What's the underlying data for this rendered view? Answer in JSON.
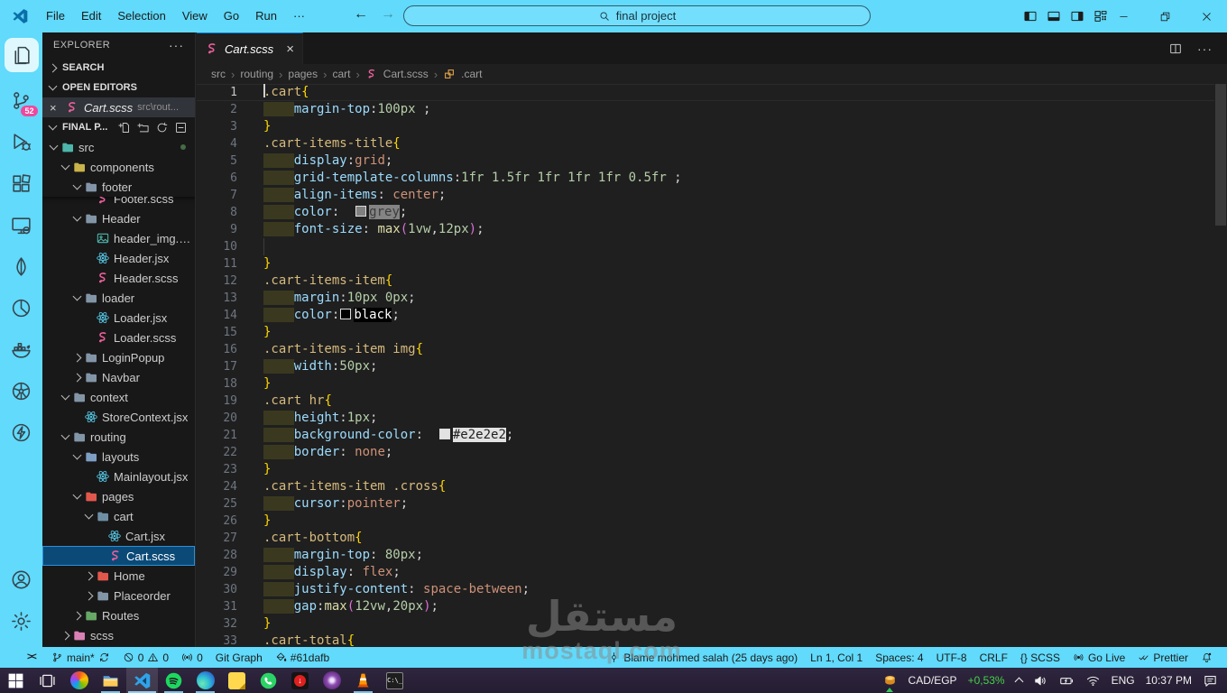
{
  "window": {
    "title_search": "final project",
    "menu": [
      "File",
      "Edit",
      "Selection",
      "View",
      "Go",
      "Run",
      "···"
    ],
    "nav": {
      "back": "←",
      "forward": "→"
    },
    "controls": {
      "minimize": "–",
      "restore": "restore",
      "close": "×"
    }
  },
  "theme": {
    "accent": "#61dafb",
    "editor_bg": "#1f1f1f",
    "sidebar_bg": "#181818",
    "selection_bg": "#0b4a77",
    "badge_pink": "#f0479c",
    "token_colors": {
      "selector": "#d7ba7d",
      "brace": "#ffd700",
      "property": "#9cdcfe",
      "number": "#b5cea8",
      "value": "#ce9178",
      "function": "#dcdcaa",
      "paren": "#da70d6"
    }
  },
  "activity_bar": {
    "top": [
      {
        "icon": "files",
        "active": true
      },
      {
        "icon": "source-control",
        "badge": "52"
      },
      {
        "icon": "run-debug"
      },
      {
        "icon": "extensions"
      },
      {
        "icon": "remote-explorer"
      },
      {
        "icon": "mongodb"
      },
      {
        "icon": "pie"
      },
      {
        "icon": "docker"
      },
      {
        "icon": "kubernetes"
      },
      {
        "icon": "thunder"
      }
    ],
    "bottom": [
      {
        "icon": "account"
      },
      {
        "icon": "gear"
      }
    ]
  },
  "sidebar": {
    "title": "EXPLORER",
    "sections": [
      {
        "label": "SEARCH",
        "collapsed": true
      },
      {
        "label": "OPEN EDITORS",
        "collapsed": false
      },
      {
        "label": "FINAL P...",
        "collapsed": false,
        "actions": [
          "new-file",
          "new-folder",
          "refresh",
          "collapse-all"
        ]
      }
    ],
    "open_editor": {
      "file": "Cart.scss",
      "desc": "src\\rout...",
      "icon": "sass"
    },
    "tree": [
      {
        "label": "src",
        "kind": "folder",
        "color": "#4db6ac",
        "level": 1,
        "expanded": true,
        "deco": true
      },
      {
        "label": "components",
        "kind": "folder",
        "color": "#c9b34a",
        "level": 2,
        "expanded": true
      },
      {
        "label": "footer",
        "kind": "folder",
        "color": "#8295a7",
        "level": 3,
        "expanded": true
      },
      {
        "label": "Footer.scss",
        "kind": "file",
        "icon": "sass",
        "level": 4,
        "partial": true
      },
      {
        "label": "Header",
        "kind": "folder",
        "color": "#8295a7",
        "level": 3,
        "expanded": true
      },
      {
        "label": "header_img.p...",
        "kind": "file",
        "icon": "image",
        "level": 4
      },
      {
        "label": "Header.jsx",
        "kind": "file",
        "icon": "react",
        "level": 4
      },
      {
        "label": "Header.scss",
        "kind": "file",
        "icon": "sass",
        "level": 4
      },
      {
        "label": "loader",
        "kind": "folder",
        "color": "#8295a7",
        "level": 3,
        "expanded": true
      },
      {
        "label": "Loader.jsx",
        "kind": "file",
        "icon": "react",
        "level": 4
      },
      {
        "label": "Loader.scss",
        "kind": "file",
        "icon": "sass",
        "level": 4
      },
      {
        "label": "LoginPopup",
        "kind": "folder",
        "color": "#8295a7",
        "level": 3,
        "expanded": false
      },
      {
        "label": "Navbar",
        "kind": "folder",
        "color": "#8295a7",
        "level": 3,
        "expanded": false
      },
      {
        "label": "context",
        "kind": "folder",
        "color": "#8295a7",
        "level": 2,
        "expanded": true
      },
      {
        "label": "StoreContext.jsx",
        "kind": "file",
        "icon": "react",
        "level": 3
      },
      {
        "label": "routing",
        "kind": "folder",
        "color": "#8295a7",
        "level": 2,
        "expanded": true
      },
      {
        "label": "layouts",
        "kind": "folder",
        "color": "#7e9fc4",
        "level": 3,
        "expanded": true
      },
      {
        "label": "Mainlayout.jsx",
        "kind": "file",
        "icon": "react",
        "level": 4
      },
      {
        "label": "pages",
        "kind": "folder",
        "color": "#e2574c",
        "level": 3,
        "expanded": true
      },
      {
        "label": "cart",
        "kind": "folder",
        "color": "#6e8fa3",
        "level": 4,
        "expanded": true
      },
      {
        "label": "Cart.jsx",
        "kind": "file",
        "icon": "react",
        "level": 5
      },
      {
        "label": "Cart.scss",
        "kind": "file",
        "icon": "sass",
        "level": 5,
        "selected": true
      },
      {
        "label": "Home",
        "kind": "folder",
        "color": "#e2574c",
        "level": 4,
        "expanded": false
      },
      {
        "label": "Placeorder",
        "kind": "folder",
        "color": "#8295a7",
        "level": 4,
        "expanded": false
      },
      {
        "label": "Routes",
        "kind": "folder",
        "color": "#66a865",
        "level": 3,
        "expanded": false
      },
      {
        "label": "scss",
        "kind": "folder",
        "color": "#d981b5",
        "level": 2,
        "expanded": false
      }
    ]
  },
  "editor": {
    "tab": {
      "label": "Cart.scss",
      "icon": "sass",
      "close": "×"
    },
    "breadcrumbs": [
      {
        "label": "src"
      },
      {
        "label": "routing"
      },
      {
        "label": "pages"
      },
      {
        "label": "cart"
      },
      {
        "label": "Cart.scss",
        "icon": "sass"
      },
      {
        "label": ".cart",
        "icon": "symbol-class"
      }
    ],
    "swatches": {
      "grey": "#808080",
      "black": "#000000",
      "light": "#e2e2e2"
    },
    "code_lines": [
      {
        "n": 1,
        "ind": 0,
        "tk": [
          [
            "s",
            ".cart"
          ],
          [
            "b",
            "{"
          ]
        ]
      },
      {
        "n": 2,
        "ind": 1,
        "tk": [
          [
            "p",
            "margin-top"
          ],
          [
            "u",
            ":"
          ],
          [
            "n",
            "100px"
          ],
          [
            "u",
            " ;"
          ]
        ]
      },
      {
        "n": 3,
        "ind": 0,
        "tk": [
          [
            "b",
            "}"
          ]
        ]
      },
      {
        "n": 4,
        "ind": 0,
        "tk": [
          [
            "s",
            ".cart-items-title"
          ],
          [
            "b",
            "{"
          ]
        ]
      },
      {
        "n": 5,
        "ind": 1,
        "tk": [
          [
            "p",
            "display"
          ],
          [
            "u",
            ":"
          ],
          [
            "v",
            "grid"
          ],
          [
            "u",
            ";"
          ]
        ]
      },
      {
        "n": 6,
        "ind": 1,
        "tk": [
          [
            "p",
            "grid-template-columns"
          ],
          [
            "u",
            ":"
          ],
          [
            "n",
            "1fr 1.5fr 1fr 1fr 1fr 0.5fr"
          ],
          [
            "u",
            " ;"
          ]
        ]
      },
      {
        "n": 7,
        "ind": 1,
        "tk": [
          [
            "p",
            "align-items"
          ],
          [
            "u",
            ": "
          ],
          [
            "v",
            "center"
          ],
          [
            "u",
            ";"
          ]
        ]
      },
      {
        "n": 8,
        "ind": 1,
        "tk": [
          [
            "p",
            "color"
          ],
          [
            "u",
            ":  "
          ],
          [
            "sw",
            "grey"
          ],
          [
            "hg",
            "grey"
          ],
          [
            "u",
            ";"
          ]
        ]
      },
      {
        "n": 9,
        "ind": 1,
        "tk": [
          [
            "p",
            "font-size"
          ],
          [
            "u",
            ": "
          ],
          [
            "f",
            "max"
          ],
          [
            "r",
            "("
          ],
          [
            "n",
            "1vw"
          ],
          [
            "u",
            ","
          ],
          [
            "n",
            "12px"
          ],
          [
            "r",
            ")"
          ],
          [
            "u",
            ";"
          ]
        ]
      },
      {
        "n": 10,
        "ind": 0,
        "guide": true,
        "tk": []
      },
      {
        "n": 11,
        "ind": 0,
        "tk": [
          [
            "b",
            "}"
          ]
        ]
      },
      {
        "n": 12,
        "ind": 0,
        "tk": [
          [
            "s",
            ".cart-items-item"
          ],
          [
            "b",
            "{"
          ]
        ]
      },
      {
        "n": 13,
        "ind": 1,
        "tk": [
          [
            "p",
            "margin"
          ],
          [
            "u",
            ":"
          ],
          [
            "n",
            "10px 0px"
          ],
          [
            "u",
            ";"
          ]
        ]
      },
      {
        "n": 14,
        "ind": 1,
        "tk": [
          [
            "p",
            "color"
          ],
          [
            "u",
            ":"
          ],
          [
            "sw",
            "black"
          ],
          [
            "hb",
            "black"
          ],
          [
            "u",
            ";"
          ]
        ]
      },
      {
        "n": 15,
        "ind": 0,
        "tk": [
          [
            "b",
            "}"
          ]
        ]
      },
      {
        "n": 16,
        "ind": 0,
        "tk": [
          [
            "s",
            ".cart-items-item img"
          ],
          [
            "b",
            "{"
          ]
        ]
      },
      {
        "n": 17,
        "ind": 1,
        "tk": [
          [
            "p",
            "width"
          ],
          [
            "u",
            ":"
          ],
          [
            "n",
            "50px"
          ],
          [
            "u",
            ";"
          ]
        ]
      },
      {
        "n": 18,
        "ind": 0,
        "tk": [
          [
            "b",
            "}"
          ]
        ]
      },
      {
        "n": 19,
        "ind": 0,
        "tk": [
          [
            "s",
            ".cart hr"
          ],
          [
            "b",
            "{"
          ]
        ]
      },
      {
        "n": 20,
        "ind": 1,
        "tk": [
          [
            "p",
            "height"
          ],
          [
            "u",
            ":"
          ],
          [
            "n",
            "1px"
          ],
          [
            "u",
            ";"
          ]
        ]
      },
      {
        "n": 21,
        "ind": 1,
        "tk": [
          [
            "p",
            "background-color"
          ],
          [
            "u",
            ":  "
          ],
          [
            "sw",
            "light"
          ],
          [
            "hl",
            "#e2e2e2"
          ],
          [
            "u",
            ";"
          ]
        ]
      },
      {
        "n": 22,
        "ind": 1,
        "tk": [
          [
            "p",
            "border"
          ],
          [
            "u",
            ": "
          ],
          [
            "v",
            "none"
          ],
          [
            "u",
            ";"
          ]
        ]
      },
      {
        "n": 23,
        "ind": 0,
        "tk": [
          [
            "b",
            "}"
          ]
        ]
      },
      {
        "n": 24,
        "ind": 0,
        "tk": [
          [
            "s",
            ".cart-items-item .cross"
          ],
          [
            "b",
            "{"
          ]
        ]
      },
      {
        "n": 25,
        "ind": 1,
        "tk": [
          [
            "p",
            "cursor"
          ],
          [
            "u",
            ":"
          ],
          [
            "v",
            "pointer"
          ],
          [
            "u",
            ";"
          ]
        ]
      },
      {
        "n": 26,
        "ind": 0,
        "tk": [
          [
            "b",
            "}"
          ]
        ]
      },
      {
        "n": 27,
        "ind": 0,
        "tk": [
          [
            "s",
            ".cart-bottom"
          ],
          [
            "b",
            "{"
          ]
        ]
      },
      {
        "n": 28,
        "ind": 1,
        "tk": [
          [
            "p",
            "margin-top"
          ],
          [
            "u",
            ": "
          ],
          [
            "n",
            "80px"
          ],
          [
            "u",
            ";"
          ]
        ]
      },
      {
        "n": 29,
        "ind": 1,
        "tk": [
          [
            "p",
            "display"
          ],
          [
            "u",
            ": "
          ],
          [
            "v",
            "flex"
          ],
          [
            "u",
            ";"
          ]
        ]
      },
      {
        "n": 30,
        "ind": 1,
        "tk": [
          [
            "p",
            "justify-content"
          ],
          [
            "u",
            ": "
          ],
          [
            "v",
            "space-between"
          ],
          [
            "u",
            ";"
          ]
        ]
      },
      {
        "n": 31,
        "ind": 1,
        "tk": [
          [
            "p",
            "gap"
          ],
          [
            "u",
            ":"
          ],
          [
            "f",
            "max"
          ],
          [
            "r",
            "("
          ],
          [
            "n",
            "12vw"
          ],
          [
            "u",
            ","
          ],
          [
            "n",
            "20px"
          ],
          [
            "r",
            ")"
          ],
          [
            "u",
            ";"
          ]
        ]
      },
      {
        "n": 32,
        "ind": 0,
        "tk": [
          [
            "b",
            "}"
          ]
        ]
      },
      {
        "n": 33,
        "ind": 0,
        "tk": [
          [
            "s",
            ".cart-total"
          ],
          [
            "b",
            "{"
          ]
        ]
      }
    ]
  },
  "status_bar": {
    "left": [
      {
        "key": "remote",
        "parts": [
          {
            "ic": "remote"
          }
        ]
      },
      {
        "key": "branch",
        "parts": [
          {
            "ic": "branch"
          },
          {
            "tx": "main*"
          },
          {
            "ic": "sync"
          }
        ]
      },
      {
        "key": "problems",
        "parts": [
          {
            "ic": "error"
          },
          {
            "tx": "0"
          },
          {
            "ic": "warning"
          },
          {
            "tx": "0"
          }
        ]
      },
      {
        "key": "ports",
        "parts": [
          {
            "ic": "radio"
          },
          {
            "tx": "0"
          }
        ]
      },
      {
        "key": "git-graph",
        "parts": [
          {
            "tx": "Git Graph"
          }
        ]
      },
      {
        "key": "peacock",
        "parts": [
          {
            "ic": "bucket"
          },
          {
            "tx": "#61dafb"
          }
        ]
      }
    ],
    "right": [
      {
        "key": "blame",
        "parts": [
          {
            "ic": "commit"
          },
          {
            "tx": "Blame mohmed salah (25 days ago)"
          }
        ]
      },
      {
        "key": "cursor-position",
        "parts": [
          {
            "tx": "Ln 1, Col 1"
          }
        ]
      },
      {
        "key": "indentation",
        "parts": [
          {
            "tx": "Spaces: 4"
          }
        ]
      },
      {
        "key": "encoding",
        "parts": [
          {
            "tx": "UTF-8"
          }
        ]
      },
      {
        "key": "eol",
        "parts": [
          {
            "tx": "CRLF"
          }
        ]
      },
      {
        "key": "language",
        "parts": [
          {
            "tx": "{} SCSS"
          }
        ]
      },
      {
        "key": "go-live",
        "parts": [
          {
            "ic": "golive"
          },
          {
            "tx": "Go Live"
          }
        ]
      },
      {
        "key": "prettier",
        "parts": [
          {
            "ic": "prettier"
          },
          {
            "tx": "Prettier"
          }
        ]
      },
      {
        "key": "notifications",
        "parts": [
          {
            "ic": "bell"
          }
        ]
      }
    ]
  },
  "taskbar": {
    "apps": [
      {
        "id": "task-view"
      },
      {
        "id": "copilot"
      },
      {
        "id": "file-explorer",
        "running": true
      },
      {
        "id": "vscode",
        "running": true,
        "active": true
      },
      {
        "id": "spotify",
        "running": true
      },
      {
        "id": "edge",
        "running": true
      },
      {
        "id": "sticky-notes"
      },
      {
        "id": "whatsapp"
      },
      {
        "id": "download-app"
      },
      {
        "id": "tor"
      },
      {
        "id": "vlc",
        "running": true
      },
      {
        "id": "terminal"
      }
    ],
    "tray": {
      "ticker_pair": "CAD/EGP",
      "ticker_change": "+0,53%",
      "language": "ENG",
      "time": "10:37 PM"
    }
  },
  "watermark": {
    "line1": "مستقل",
    "line2": "mostaql.com"
  }
}
